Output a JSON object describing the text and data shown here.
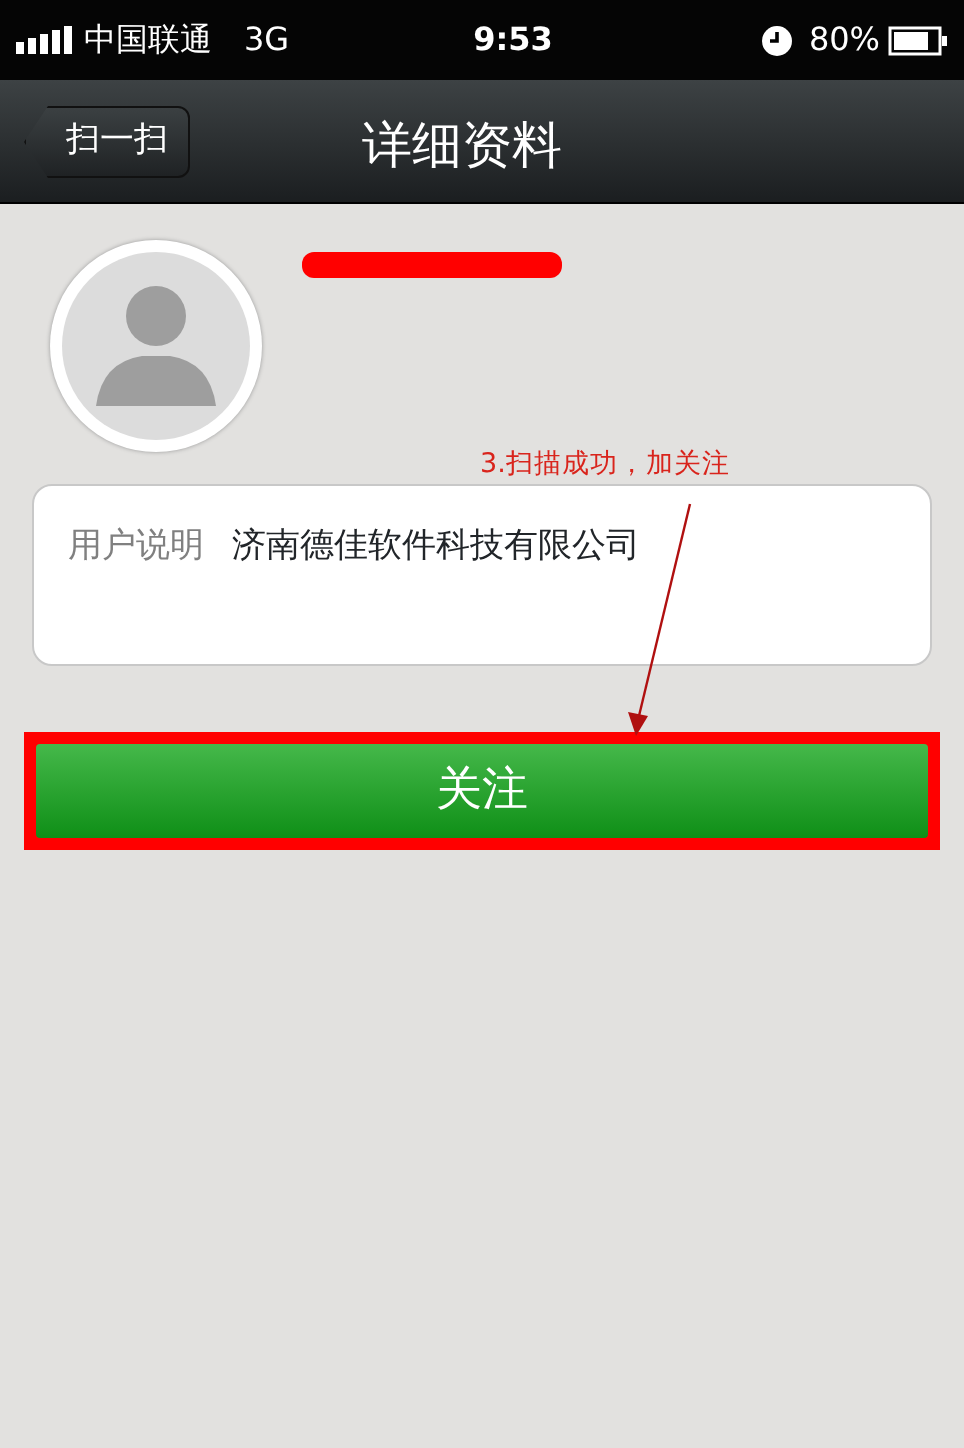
{
  "status_bar": {
    "carrier": "中国联通",
    "network": "3G",
    "time": "9:53",
    "battery": "80%"
  },
  "nav_bar": {
    "back": "扫一扫",
    "title": "详细资料"
  },
  "profile": {
    "description_label": "用户说明",
    "description": "济南德佳软件科技有限公司"
  },
  "follow_button": {
    "label": "关注",
    "highlighted": true
  },
  "annotation": {
    "text": "3.扫描成功，加关注"
  }
}
